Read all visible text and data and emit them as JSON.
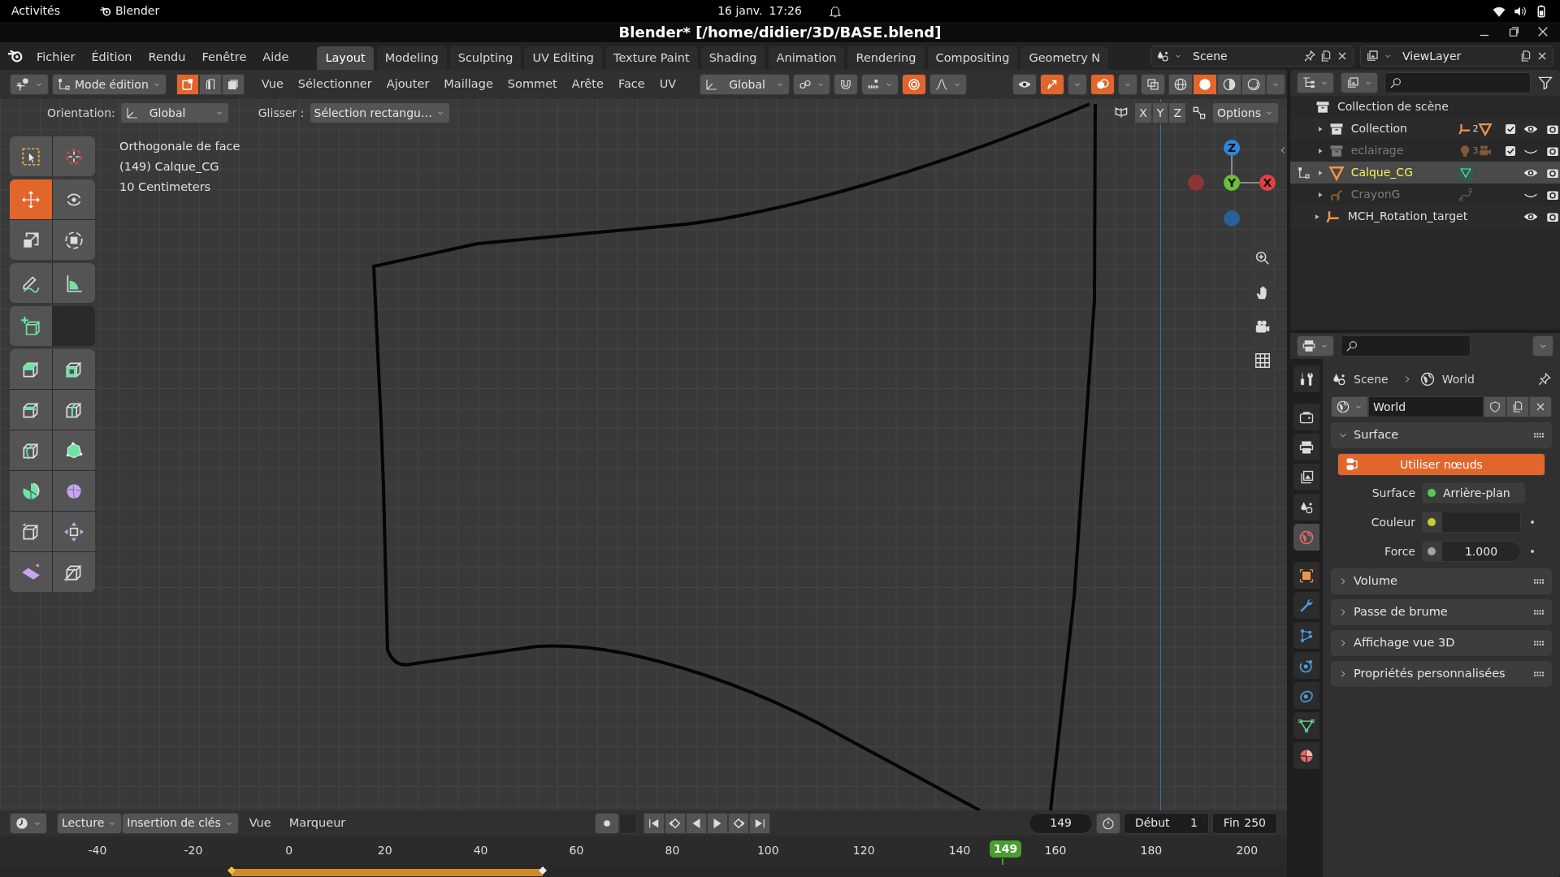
{
  "system_bar": {
    "activities": "Activités",
    "app": "Blender",
    "date": "16 janv.",
    "time": "17:26"
  },
  "window": {
    "title": "Blender* [/home/didier/3D/BASE.blend]"
  },
  "menus": [
    "Fichier",
    "Édition",
    "Rendu",
    "Fenêtre",
    "Aide"
  ],
  "workspaces": [
    {
      "label": "Layout",
      "selected": true
    },
    {
      "label": "Modeling",
      "selected": false
    },
    {
      "label": "Sculpting",
      "selected": false
    },
    {
      "label": "UV Editing",
      "selected": false
    },
    {
      "label": "Texture Paint",
      "selected": false
    },
    {
      "label": "Shading",
      "selected": false
    },
    {
      "label": "Animation",
      "selected": false
    },
    {
      "label": "Rendering",
      "selected": false
    },
    {
      "label": "Compositing",
      "selected": false
    },
    {
      "label": "Geometry N",
      "selected": false
    }
  ],
  "scene": {
    "value": "Scene"
  },
  "view_layer": {
    "value": "ViewLayer"
  },
  "viewport_header": {
    "mode": "Mode édition",
    "select_modes": [
      {
        "kind": "vertex",
        "selected": true
      },
      {
        "kind": "edge",
        "selected": false
      },
      {
        "kind": "face",
        "selected": false
      }
    ],
    "menus": [
      "Vue",
      "Sélectionner",
      "Ajouter",
      "Maillage",
      "Sommet",
      "Arête",
      "Face",
      "UV"
    ],
    "transform_orientation": "Global",
    "toggles": [
      {
        "kind": "snap",
        "on": false
      },
      {
        "kind": "proportional",
        "on": true
      },
      {
        "kind": "visibility",
        "on": false
      },
      {
        "kind": "gizmo",
        "on": true
      },
      {
        "kind": "overlay",
        "on": true
      },
      {
        "kind": "xray",
        "on": false
      }
    ],
    "shading": [
      {
        "kind": "wireframe",
        "selected": false
      },
      {
        "kind": "solid",
        "selected": true
      },
      {
        "kind": "material",
        "selected": false
      },
      {
        "kind": "rendered",
        "selected": false
      }
    ]
  },
  "tool_settings": {
    "orientation_label": "Orientation:",
    "orientation": "Global",
    "drag_label": "Glisser :",
    "drag": "Sélection rectangu…",
    "mirror_axes": [
      "X",
      "Y",
      "Z"
    ],
    "options": "Options"
  },
  "viewport": {
    "info": [
      "Orthogonale de face",
      "(149) Calque_CG",
      "10 Centimeters"
    ],
    "gizmo": [
      {
        "kind": "z",
        "label": "Z",
        "color": "#2e84e0"
      },
      {
        "kind": "y",
        "label": "Y",
        "color": "#6cbf3a"
      },
      {
        "kind": "x",
        "label": "X",
        "color": "#e3413f"
      }
    ]
  },
  "toolbar": [
    [
      {
        "kind": "select_box",
        "selected": false
      },
      {
        "kind": "cursor",
        "selected": false
      }
    ],
    [
      {
        "kind": "move",
        "selected": true
      },
      {
        "kind": "rotate",
        "selected": false
      },
      {
        "kind": "scale",
        "selected": false
      },
      {
        "kind": "transform",
        "selected": false
      }
    ],
    [
      {
        "kind": "annotate",
        "selected": false
      },
      {
        "kind": "measure",
        "selected": false
      }
    ],
    [
      {
        "kind": "add_cube",
        "selected": false
      }
    ],
    [
      {
        "kind": "extrude",
        "selected": false
      },
      {
        "kind": "inset",
        "selected": false
      },
      {
        "kind": "bevel",
        "selected": false
      },
      {
        "kind": "loop_cut",
        "selected": false
      },
      {
        "kind": "knife",
        "selected": false
      },
      {
        "kind": "poly_build",
        "selected": false
      },
      {
        "kind": "spin",
        "selected": false
      },
      {
        "kind": "smooth",
        "selected": false
      },
      {
        "kind": "edge_slide",
        "selected": false
      },
      {
        "kind": "shrink",
        "selected": false
      },
      {
        "kind": "shear",
        "selected": false
      },
      {
        "kind": "rip",
        "selected": false
      }
    ]
  ],
  "outliner": {
    "root": "Collection de scène",
    "children": [
      {
        "kind": "collection",
        "name": "Collection",
        "badge": "2",
        "dimmed": false,
        "selected": false,
        "checked": true,
        "visible": true
      },
      {
        "kind": "collection_lights",
        "name": "eclairage",
        "badge": "3",
        "dimmed": true,
        "selected": false,
        "checked": true,
        "visible": false
      },
      {
        "kind": "mesh",
        "name": "Calque_CG",
        "dimmed": false,
        "selected": true,
        "visible": true
      },
      {
        "kind": "grease_pencil",
        "name": "CrayonG",
        "dimmed": true,
        "selected": false,
        "visible": false
      },
      {
        "kind": "empty",
        "name": "MCH_Rotation_target",
        "dimmed": false,
        "selected": false,
        "visible": true
      }
    ]
  },
  "properties": {
    "tabs": [
      {
        "kind": "tool",
        "selected": false
      },
      {
        "kind": "render",
        "selected": false
      },
      {
        "kind": "output",
        "selected": false
      },
      {
        "kind": "view_layer",
        "selected": false
      },
      {
        "kind": "scene",
        "selected": false
      },
      {
        "kind": "world",
        "selected": true
      },
      {
        "kind": "object",
        "selected": false
      },
      {
        "kind": "modifiers",
        "selected": false
      },
      {
        "kind": "particles",
        "selected": false
      },
      {
        "kind": "physics",
        "selected": false
      },
      {
        "kind": "constraints",
        "selected": false
      },
      {
        "kind": "data",
        "selected": false
      },
      {
        "kind": "material",
        "selected": false
      }
    ],
    "breadcrumb": [
      "Scene",
      "World"
    ],
    "datablock": "World",
    "use_nodes": "Utiliser nœuds",
    "fields": [
      {
        "kind": "shader",
        "label": "Surface",
        "value": "Arrière-plan",
        "color": "#5ec45e"
      },
      {
        "kind": "color",
        "label": "Couleur",
        "color": "#c9c93a"
      },
      {
        "kind": "number",
        "label": "Force",
        "value": "1.000",
        "color": "#a3a3a3"
      }
    ],
    "panels": [
      {
        "title": "Surface",
        "expanded": true
      },
      {
        "title": "Volume",
        "expanded": false
      },
      {
        "title": "Passe de brume",
        "expanded": false
      },
      {
        "title": "Affichage vue 3D",
        "expanded": false
      },
      {
        "title": "Propriétés personnalisées",
        "expanded": false
      }
    ]
  },
  "timeline": {
    "playback": "Lecture",
    "keying": "Insertion de clés",
    "menus": [
      "Vue",
      "Marqueur"
    ],
    "current_frame": "149",
    "start_label": "Début",
    "start": "1",
    "end_label": "Fin",
    "end": "250",
    "ruler": [
      "-40",
      "-20",
      "0",
      "20",
      "40",
      "60",
      "80",
      "100",
      "120",
      "140",
      "160",
      "180",
      "200"
    ],
    "playhead": "149"
  }
}
